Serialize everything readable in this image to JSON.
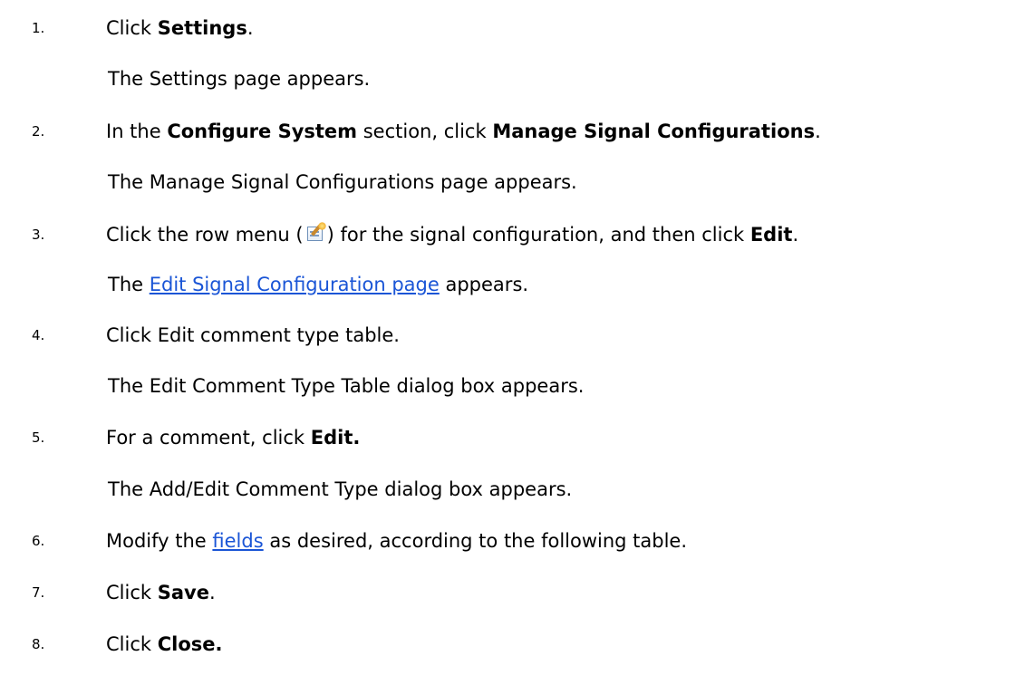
{
  "steps": [
    {
      "number": "1.",
      "click": "Click ",
      "settings": "Settings",
      "period": ".",
      "result": "The Settings page appears."
    },
    {
      "number": "2.",
      "in_the": "In the ",
      "configure_system": "Configure System",
      "section_click": " section, click ",
      "manage_signal_configurations": "Manage Signal Configurations",
      "period": ".",
      "result": "The Manage Signal Configurations page appears."
    },
    {
      "number": "3.",
      "click_row_menu": "Click the row menu (",
      "icon": "row-menu-icon",
      "after_icon": ") for the signal configuration, and then click ",
      "edit": "Edit",
      "period": ".",
      "result_prefix": "The ",
      "result_link": "Edit Signal Configuration page",
      "result_suffix": " appears."
    },
    {
      "number": "4.",
      "text": "Click Edit comment type table.",
      "result": "The Edit Comment Type Table dialog box appears."
    },
    {
      "number": "5.",
      "prefix": "For a comment, click ",
      "edit": "Edit.",
      "result": "The Add/Edit Comment Type dialog box appears."
    },
    {
      "number": "6.",
      "prefix": "Modify the ",
      "link": "fields",
      "suffix": " as desired, according to the following table."
    },
    {
      "number": "7.",
      "prefix": "Click ",
      "save": "Save",
      "period": "."
    },
    {
      "number": "8.",
      "prefix": "Click ",
      "close": "Close."
    }
  ],
  "colors": {
    "link": "#1a55d6",
    "text": "#000000"
  }
}
